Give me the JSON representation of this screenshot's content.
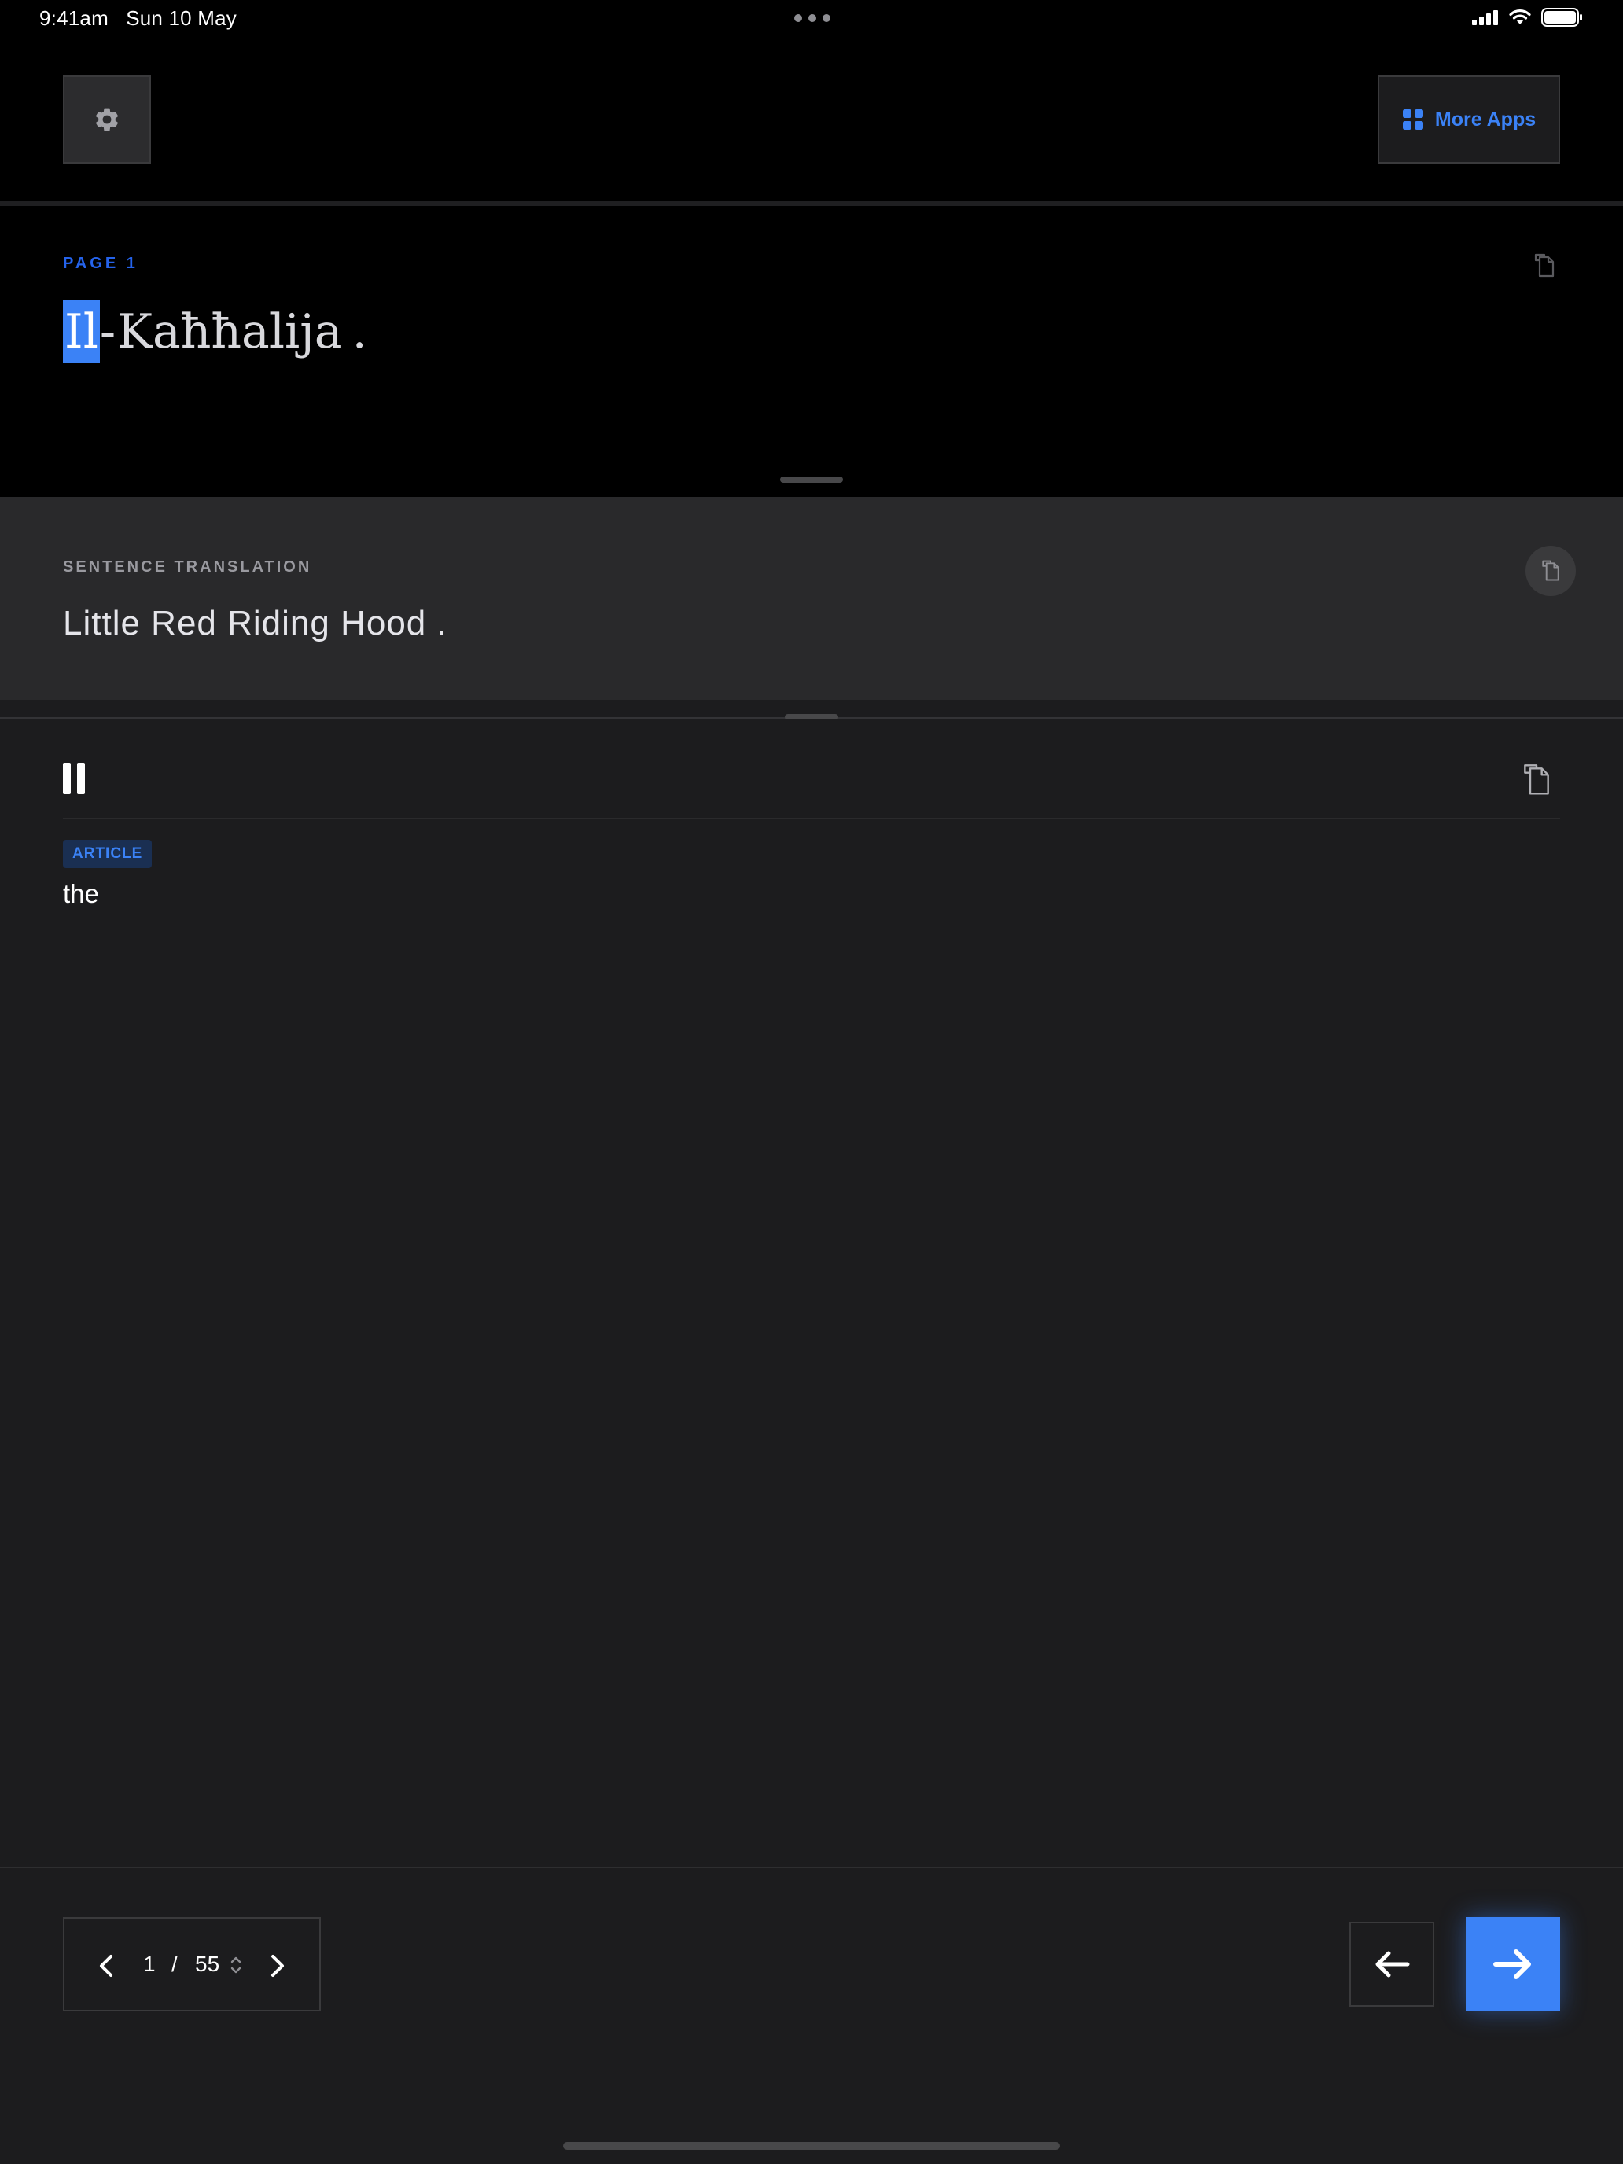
{
  "status_bar": {
    "time": "9:41am",
    "date": "Sun 10 May"
  },
  "header": {
    "more_apps_label": "More Apps"
  },
  "original": {
    "page_label": "PAGE 1",
    "words": [
      "Il",
      "-",
      "Kaħħalija",
      "."
    ],
    "active_word_index": 0
  },
  "translation": {
    "label": "SENTENCE TRANSLATION",
    "text": "Little Red Riding Hood ."
  },
  "detail": {
    "part_of_speech": "ARTICLE",
    "meaning": "the"
  },
  "pager": {
    "current": "1",
    "separator": "/",
    "total": "55"
  },
  "colors": {
    "accent": "#3b82f6",
    "background": "#1c1c1e",
    "panel_black": "#000000",
    "translation_bg": "#29292b"
  }
}
